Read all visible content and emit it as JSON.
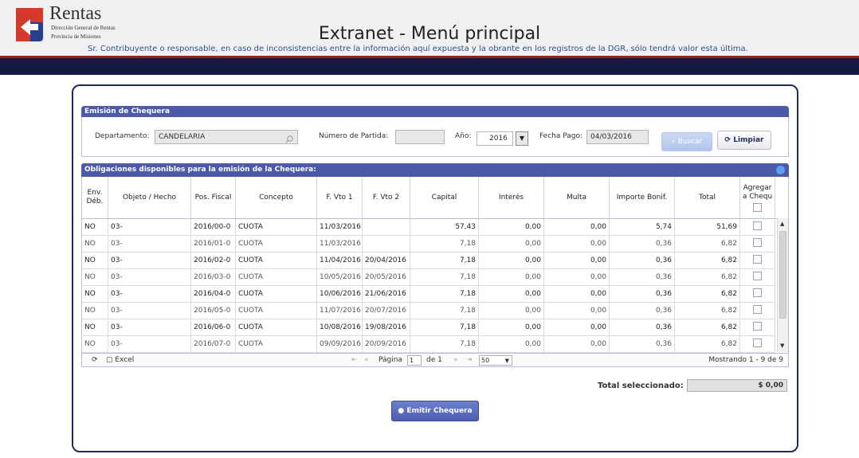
{
  "header": {
    "brand": "Rentas",
    "brand_sub1": "Dirección General de Rentas",
    "brand_sub2": "Provincia de Misiones",
    "title": "Extranet - Menú principal",
    "disclaimer": "Sr. Contribuyente o responsable, en caso de inconsistencias entre la información aquí expuesta y la obrante en los registros de la DGR, sólo tendrá valor esta última."
  },
  "colors": {
    "nav": "#151a45",
    "accent_red": "#a61c1c",
    "panel_header": "#4a5aa8"
  },
  "emision": {
    "title": "Emisión de Chequera",
    "departamento_label": "Departamento:",
    "departamento_value": "CANDELARIA",
    "partida_label": "Número de Partida:",
    "partida_value": "",
    "anio_label": "Año:",
    "anio_value": "2016",
    "fecha_label": "Fecha Pago:",
    "fecha_value": "04/03/2016",
    "buscar_label": "Buscar",
    "limpiar_label": "Limpiar"
  },
  "obligaciones": {
    "title": "Obligaciones disponibles para la emisión de la Chequera:",
    "columns": {
      "env": "Env. Déb.",
      "objeto": "Objeto / Hecho",
      "pos": "Pos. Fiscal",
      "concepto": "Concepto",
      "fvto1": "F. Vto 1",
      "fvto2": "F. Vto 2",
      "capital": "Capital",
      "interes": "Interés",
      "multa": "Multa",
      "bonif": "Importe Bonif.",
      "total": "Total",
      "agregar": "Agregar a Chequ"
    },
    "rows": [
      {
        "env": "NO",
        "objeto": "03-",
        "pos": "2016/00-0",
        "concepto": "CUOTA",
        "fvto1": "11/03/2016",
        "fvto2": "",
        "capital": "57,43",
        "interes": "0,00",
        "multa": "0,00",
        "bonif": "5,74",
        "total": "51,69"
      },
      {
        "env": "NO",
        "objeto": "03-",
        "pos": "2016/01-0",
        "concepto": "CUOTA",
        "fvto1": "11/03/2016",
        "fvto2": "",
        "capital": "7,18",
        "interes": "0,00",
        "multa": "0,00",
        "bonif": "0,36",
        "total": "6,82"
      },
      {
        "env": "NO",
        "objeto": "03-",
        "pos": "2016/02-0",
        "concepto": "CUOTA",
        "fvto1": "11/04/2016",
        "fvto2": "20/04/2016",
        "capital": "7,18",
        "interes": "0,00",
        "multa": "0,00",
        "bonif": "0,36",
        "total": "6,82"
      },
      {
        "env": "NO",
        "objeto": "03-",
        "pos": "2016/03-0",
        "concepto": "CUOTA",
        "fvto1": "10/05/2016",
        "fvto2": "20/05/2016",
        "capital": "7,18",
        "interes": "0,00",
        "multa": "0,00",
        "bonif": "0,36",
        "total": "6,82"
      },
      {
        "env": "NO",
        "objeto": "03-",
        "pos": "2016/04-0",
        "concepto": "CUOTA",
        "fvto1": "10/06/2016",
        "fvto2": "21/06/2016",
        "capital": "7,18",
        "interes": "0,00",
        "multa": "0,00",
        "bonif": "0,36",
        "total": "6,82"
      },
      {
        "env": "NO",
        "objeto": "03-",
        "pos": "2016/05-0",
        "concepto": "CUOTA",
        "fvto1": "11/07/2016",
        "fvto2": "20/07/2016",
        "capital": "7,18",
        "interes": "0,00",
        "multa": "0,00",
        "bonif": "0,36",
        "total": "6,82"
      },
      {
        "env": "NO",
        "objeto": "03-",
        "pos": "2016/06-0",
        "concepto": "CUOTA",
        "fvto1": "10/08/2016",
        "fvto2": "19/08/2016",
        "capital": "7,18",
        "interes": "0,00",
        "multa": "0,00",
        "bonif": "0,36",
        "total": "6,82"
      },
      {
        "env": "NO",
        "objeto": "03-",
        "pos": "2016/07-0",
        "concepto": "CUOTA",
        "fvto1": "09/09/2016",
        "fvto2": "20/09/2016",
        "capital": "7,18",
        "interes": "0,00",
        "multa": "0,00",
        "bonif": "0,36",
        "total": "6,82"
      }
    ]
  },
  "pager": {
    "excel_label": "Excel",
    "pagina_label": "Página",
    "page_value": "1",
    "of_label": "de 1",
    "page_size": "50",
    "showing": "Mostrando 1 - 9 de 9"
  },
  "summary": {
    "total_label": "Total seleccionado:",
    "total_value": "$ 0,00",
    "emitir_label": "Emitir Chequera"
  }
}
